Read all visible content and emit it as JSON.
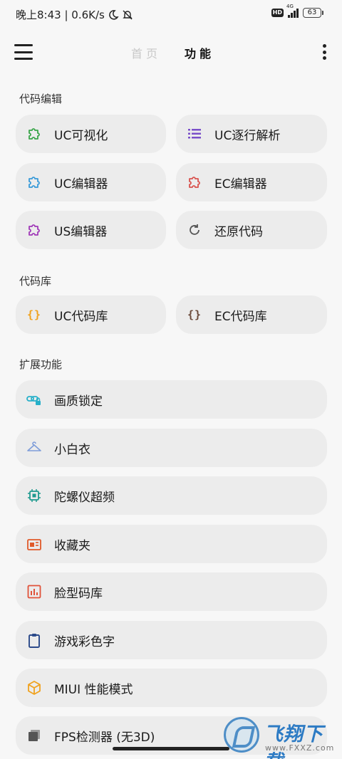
{
  "status_bar": {
    "time_speed": "晚上8:43 | 0.6K/s",
    "hd": "HD",
    "network": "4G",
    "battery": "63"
  },
  "app_bar": {
    "tab_home": "首页",
    "tab_function": "功能"
  },
  "sections": {
    "code_edit": "代码编辑",
    "code_library": "代码库",
    "extended": "扩展功能"
  },
  "items": {
    "uc_visual": "UC可视化",
    "uc_line_parse": "UC逐行解析",
    "uc_editor": "UC编辑器",
    "ec_editor": "EC编辑器",
    "us_editor": "US编辑器",
    "restore_code": "还原代码",
    "uc_code_lib": "UC代码库",
    "ec_code_lib": "EC代码库",
    "quality_lock": "画质锁定",
    "xiaobaiyi": "小白衣",
    "gyro_freq": "陀螺仪超频",
    "favorites": "收藏夹",
    "face_code_lib": "脸型码库",
    "game_color_text": "游戏彩色字",
    "miui_perf": "MIUI 性能模式",
    "fps_detector": "FPS检测器 (无3D)"
  },
  "braces": "{}",
  "watermark": {
    "text": "飞翔下载",
    "url": "www.FXXZ.com"
  },
  "colors": {
    "green": "#3aa54a",
    "purple": "#7a4fc9",
    "blue": "#3a9bd9",
    "red": "#d9534f",
    "magenta": "#a03ab8",
    "gray": "#555555",
    "orange": "#f0a21f",
    "brown": "#6b4a3a",
    "cyan": "#27b0c9",
    "light_blue": "#7e9dd9",
    "teal": "#1f9a8f",
    "orange_red": "#e05a2a",
    "red_orange": "#e0523a",
    "navy": "#2c4a8a",
    "amber": "#f0a21f",
    "dark_gray": "#555555"
  }
}
